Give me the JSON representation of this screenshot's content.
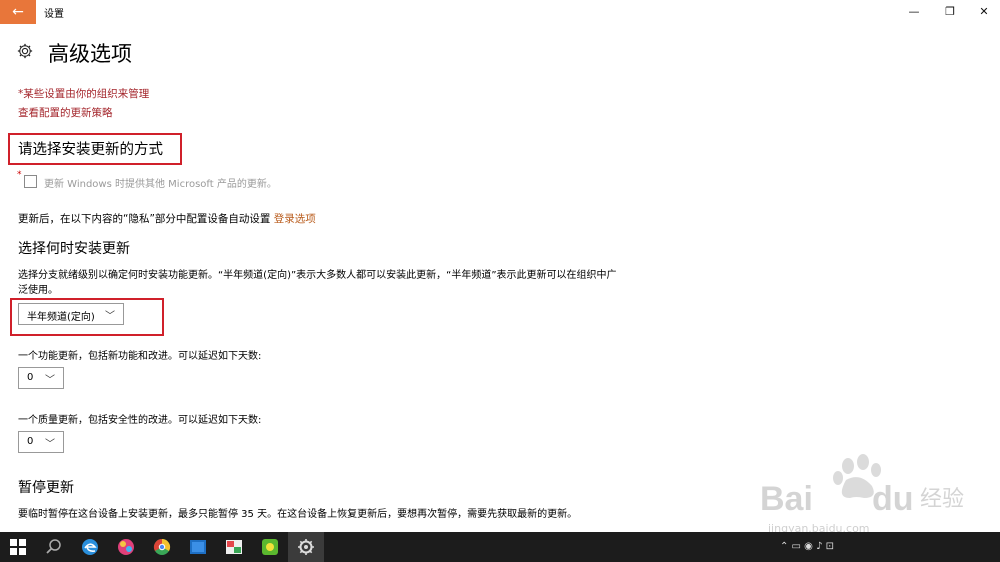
{
  "window": {
    "back_icon": "←",
    "title": "设置",
    "minimize": "—",
    "maximize": "❐",
    "close": "✕"
  },
  "page": {
    "title": "高级选项",
    "org_note": "*某些设置由你的组织来管理",
    "policy_link": "查看配置的更新策略"
  },
  "install": {
    "heading": "请选择安装更新的方式",
    "checkbox_label": "更新 Windows 时提供其他 Microsoft 产品的更新。",
    "checkbox_checked": false,
    "signin_text": "更新后，在以下内容的“隐私”部分中配置设备自动设置 ",
    "signin_link": "登录选项"
  },
  "when": {
    "heading": "选择何时安装更新",
    "description": "选择分支就绪级别以确定何时安装功能更新。“半年频道(定向)”表示大多数人都可以安装此更新，“半年频道”表示此更新可以在组织中广泛使用。",
    "channel_value": "半年频道(定向)",
    "feature_label": "一个功能更新，包括新功能和改进。可以延迟如下天数:",
    "feature_value": "0",
    "quality_label": "一个质量更新，包括安全性的改进。可以延迟如下天数:",
    "quality_value": "0"
  },
  "pause": {
    "heading": "暂停更新",
    "description": "要临时暂停在这台设备上安装更新，最多只能暂停 35 天。在这台设备上恢复更新后，要想再次暂停，需要先获取最新的更新。"
  },
  "watermark": {
    "url": "jingyan.baidu.com"
  },
  "colors": {
    "accent": "#e8763a",
    "managed_text": "#a4262c",
    "highlight_box": "#d0202a",
    "taskbar": "#1c1c1c"
  }
}
